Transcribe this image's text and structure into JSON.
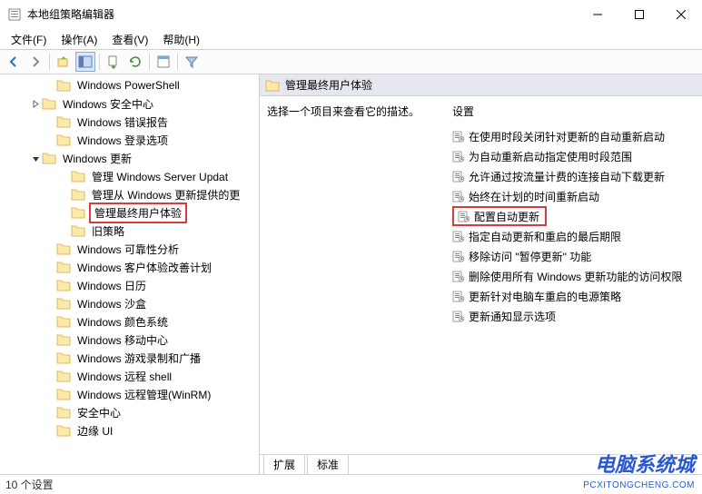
{
  "window": {
    "title": "本地组策略编辑器"
  },
  "menu": {
    "file": "文件(F)",
    "action": "操作(A)",
    "view": "查看(V)",
    "help": "帮助(H)"
  },
  "tree": {
    "items": [
      {
        "indent": 3,
        "expand": null,
        "label": "Windows PowerShell"
      },
      {
        "indent": 2,
        "expand": "closed",
        "label": "Windows 安全中心"
      },
      {
        "indent": 3,
        "expand": null,
        "label": "Windows 错误报告"
      },
      {
        "indent": 3,
        "expand": null,
        "label": "Windows 登录选项"
      },
      {
        "indent": 2,
        "expand": "open",
        "label": "Windows 更新"
      },
      {
        "indent": 4,
        "expand": null,
        "label": "管理 Windows Server Updat"
      },
      {
        "indent": 4,
        "expand": null,
        "label": "管理从 Windows 更新提供的更"
      },
      {
        "indent": 4,
        "expand": null,
        "label": "管理最终用户体验",
        "highlight": true
      },
      {
        "indent": 4,
        "expand": null,
        "label": "旧策略"
      },
      {
        "indent": 3,
        "expand": null,
        "label": "Windows 可靠性分析"
      },
      {
        "indent": 3,
        "expand": null,
        "label": "Windows 客户体验改善计划"
      },
      {
        "indent": 3,
        "expand": null,
        "label": "Windows 日历"
      },
      {
        "indent": 3,
        "expand": null,
        "label": "Windows 沙盒"
      },
      {
        "indent": 3,
        "expand": null,
        "label": "Windows 颜色系统"
      },
      {
        "indent": 3,
        "expand": null,
        "label": "Windows 移动中心"
      },
      {
        "indent": 3,
        "expand": null,
        "label": "Windows 游戏录制和广播"
      },
      {
        "indent": 3,
        "expand": null,
        "label": "Windows 远程 shell"
      },
      {
        "indent": 3,
        "expand": null,
        "label": "Windows 远程管理(WinRM)"
      },
      {
        "indent": 3,
        "expand": null,
        "label": "安全中心"
      },
      {
        "indent": 3,
        "expand": null,
        "label": "边缘 UI"
      }
    ]
  },
  "content": {
    "header": "管理最终用户体验",
    "instruction": "选择一个项目来查看它的描述。",
    "settings_heading": "设置",
    "settings": [
      {
        "label": "在使用时段关闭针对更新的自动重新启动"
      },
      {
        "label": "为自动重新启动指定使用时段范围"
      },
      {
        "label": "允许通过按流量计费的连接自动下载更新"
      },
      {
        "label": "始终在计划的时间重新启动"
      },
      {
        "label": "配置自动更新",
        "highlight": true
      },
      {
        "label": "指定自动更新和重启的最后期限"
      },
      {
        "label": "移除访问 \"暂停更新\" 功能"
      },
      {
        "label": "删除使用所有 Windows 更新功能的访问权限"
      },
      {
        "label": "更新针对电脑车重启的电源策略"
      },
      {
        "label": "更新通知显示选项"
      }
    ]
  },
  "tabs": {
    "extended": "扩展",
    "standard": "标准"
  },
  "statusbar": {
    "text": "10 个设置"
  },
  "watermark": {
    "main": "电脑系统城",
    "sub": "PCXITONGCHENG.COM"
  }
}
